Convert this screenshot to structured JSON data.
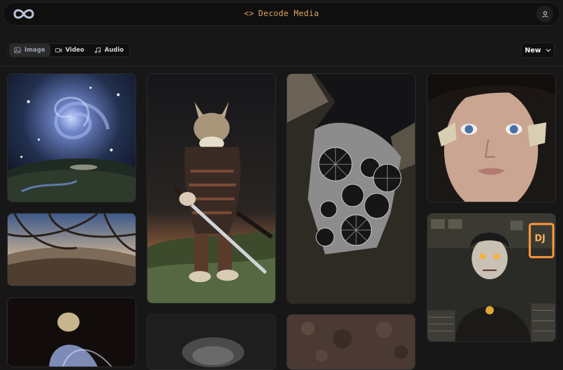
{
  "header": {
    "brand_code_glyph": "<>",
    "brand_name": "Decode Media",
    "logo_icon": "infinity-logo-icon",
    "account_icon": "user-icon"
  },
  "filters": {
    "tabs": [
      {
        "label": "Image",
        "icon": "image-icon",
        "active": true
      },
      {
        "label": "Video",
        "icon": "video-icon",
        "active": false
      },
      {
        "label": "Audio",
        "icon": "music-icon",
        "active": false
      }
    ],
    "sort": {
      "label": "New",
      "icon": "chevron-down-icon"
    }
  },
  "gallery": {
    "items": [
      {
        "subject": "spiral galaxy over valley"
      },
      {
        "subject": "fisheye landscape through branches"
      },
      {
        "subject": "figure in blue light"
      },
      {
        "subject": "cat samurai with sword"
      },
      {
        "subject": "dark partial image"
      },
      {
        "subject": "rock with radial fractal pattern"
      },
      {
        "subject": "rocky texture"
      },
      {
        "subject": "face with moths over eyes"
      },
      {
        "subject": "zombie in record store with neon sign"
      }
    ],
    "neon_sign_text": "DJ"
  },
  "colors": {
    "background": "#171717",
    "topbar": "#0f0f0f",
    "brand_accent": "#e0a55c"
  }
}
